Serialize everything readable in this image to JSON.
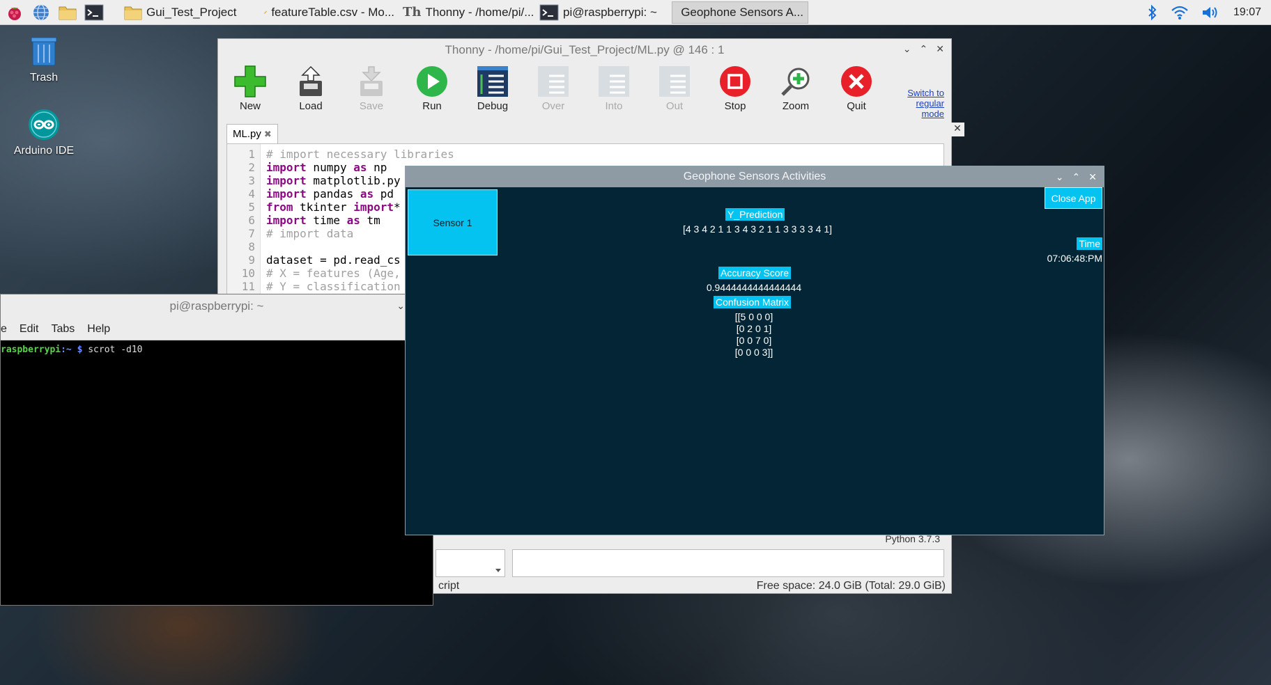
{
  "taskbar": {
    "tasks": [
      {
        "label": "Gui_Test_Project"
      },
      {
        "label": "featureTable.csv - Mo..."
      },
      {
        "label": "Thonny  -  /home/pi/..."
      },
      {
        "label": "pi@raspberrypi: ~"
      },
      {
        "label": "Geophone Sensors A..."
      }
    ],
    "clock": "19:07"
  },
  "desktop": {
    "trash_label": "Trash",
    "arduino_label": "Arduino IDE"
  },
  "thonny": {
    "title": "Thonny  -  /home/pi/Gui_Test_Project/ML.py  @  146 : 1",
    "toolbar": [
      {
        "label": "New"
      },
      {
        "label": "Load"
      },
      {
        "label": "Save"
      },
      {
        "label": "Run"
      },
      {
        "label": "Debug"
      },
      {
        "label": "Over"
      },
      {
        "label": "Into"
      },
      {
        "label": "Out"
      },
      {
        "label": "Stop"
      },
      {
        "label": "Zoom"
      },
      {
        "label": "Quit"
      }
    ],
    "switch_link": [
      "Switch to",
      "regular",
      "mode"
    ],
    "tab_label": "ML.py",
    "code_lines": [
      {
        "n": "1",
        "text": "# import necessary libraries"
      },
      {
        "n": "2",
        "kw": "import",
        "text": " numpy ",
        "kw2": "as",
        "text2": " np"
      },
      {
        "n": "3",
        "kw": "import",
        "text": " matplotlib.py"
      },
      {
        "n": "4",
        "kw": "import",
        "text": " pandas ",
        "kw2": "as",
        "text2": " pd"
      },
      {
        "n": "5",
        "kw": "from",
        "text": " tkinter ",
        "kw2": "import",
        "text2": "*"
      },
      {
        "n": "6",
        "kw": "import",
        "text": " time ",
        "kw2": "as",
        "text2": " tm"
      },
      {
        "n": "7",
        "text": "# import data"
      },
      {
        "n": "8",
        "text": ""
      },
      {
        "n": "9",
        "text": "dataset = pd.read_cs"
      },
      {
        "n": "10",
        "text": "# X = features (Age,"
      },
      {
        "n": "11",
        "text": "# Y = classification"
      }
    ],
    "python_version": "Python 3.7.3",
    "status_left": "cript",
    "status_right": "Free space: 24.0 GiB (Total: 29.0 GiB)"
  },
  "terminal": {
    "title": "pi@raspberrypi: ~",
    "menu": [
      "e",
      "Edit",
      "Tabs",
      "Help"
    ],
    "prompt_user": "raspberrypi",
    "prompt_path": ":~ $",
    "command": " scrot -d10"
  },
  "geophone": {
    "title": "Geophone Sensors Activities",
    "sensor_button": "Sensor 1",
    "close_button": "Close App",
    "y_prediction_label": "Y_Prediction",
    "y_prediction_value": "[4 3 4 2 1 1 3 4 3 2 1 1 3 3 3 3 4 1]",
    "time_label": "Time",
    "time_value": "07:06:48:PM",
    "accuracy_label": "Accuracy Score",
    "accuracy_value": "0.9444444444444444",
    "confusion_label": "Confusion Matrix",
    "confusion_rows": [
      "[[5 0 0 0]",
      "[0 2 0 1]",
      "[0 0 7 0]",
      "[0 0 0 3]]"
    ]
  }
}
